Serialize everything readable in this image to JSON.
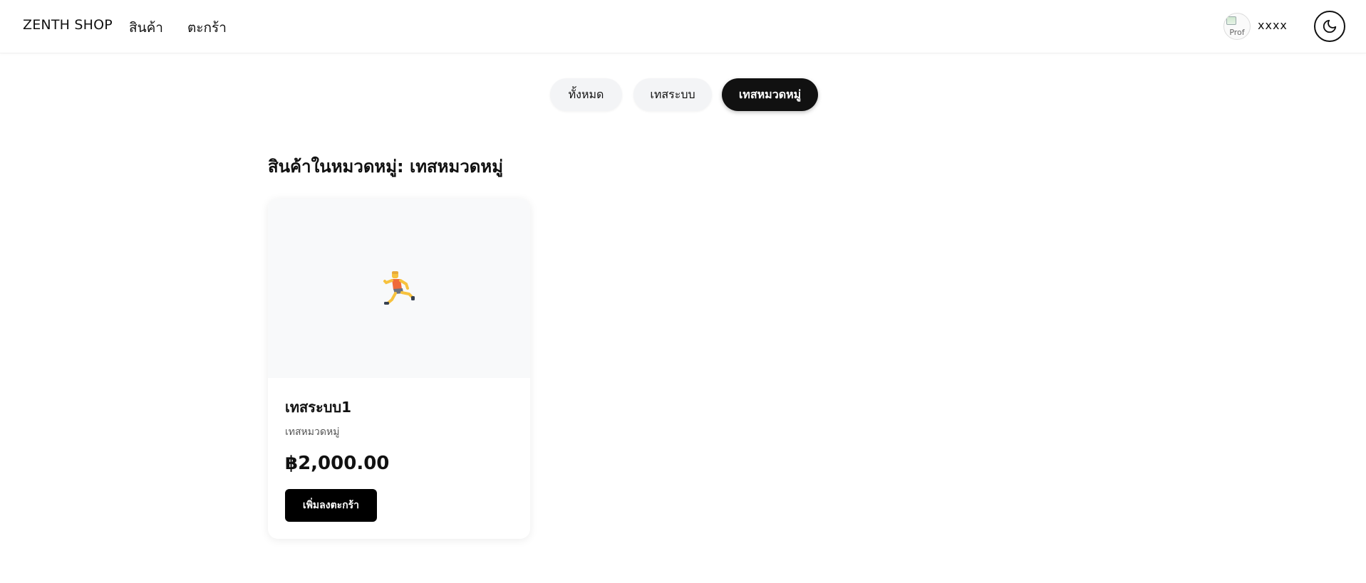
{
  "header": {
    "brand": "ZENTH SHOP",
    "nav": {
      "products": "สินค้า",
      "cart": "ตะกร้า"
    },
    "profile": {
      "avatar_alt": "Prof",
      "username": "xxxx"
    },
    "theme_toggle_icon": "moon-icon"
  },
  "categories": {
    "tabs": [
      {
        "label": "ทั้งหมด",
        "active": false
      },
      {
        "label": "เทสระบบ",
        "active": false
      },
      {
        "label": "เทสหมวดหมู่",
        "active": true
      }
    ]
  },
  "section": {
    "title": "สินค้าในหมวดหมู่: เทสหมวดหมู่"
  },
  "products": [
    {
      "image_icon": "running-person-emoji",
      "name": "เทสระบบ1",
      "category": "เทสหมวดหมู่",
      "price": "฿2,000.00",
      "add_to_cart_label": "เพิ่มลงตะกร้า"
    }
  ],
  "colors": {
    "primary": "#111111",
    "tab_inactive_bg": "#f3f4f6",
    "card_image_bg": "#f8f9fa",
    "button_bg": "#000000"
  }
}
